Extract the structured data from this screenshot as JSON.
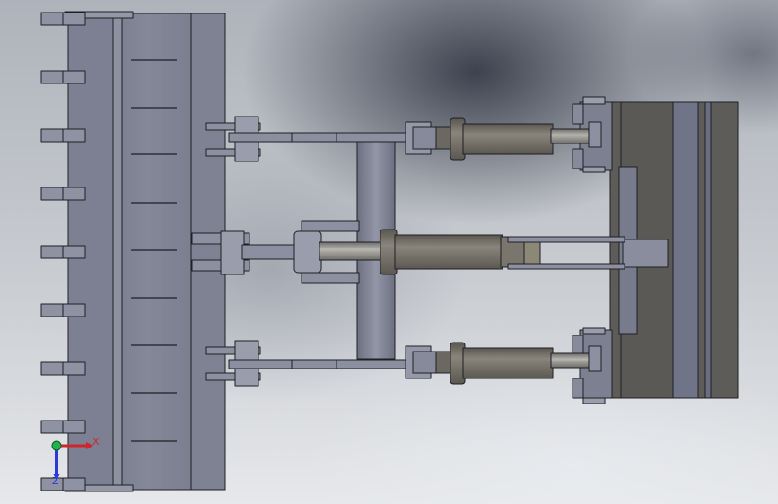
{
  "triad": {
    "x_label": "X",
    "z_label": "Z",
    "x_color": "#d0252b",
    "y_color": "#23b14d",
    "z_color": "#2b3bd8"
  },
  "colors": {
    "bucket_fill": "#7a7d8f",
    "steel_fill": "#8a8d9e",
    "cylinder_fill": "#6f6b63",
    "frame_fill": "#5c5b57",
    "outline": "#1e1f24"
  }
}
